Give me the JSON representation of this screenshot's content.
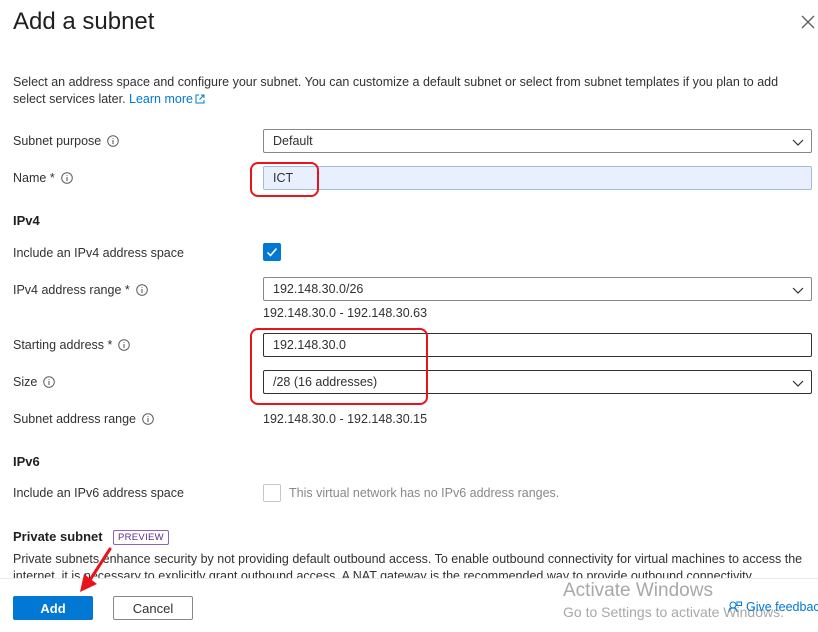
{
  "panel": {
    "title": "Add a subnet",
    "description": "Select an address space and configure your subnet. You can customize a default subnet or select from subnet templates if you plan to add select services later.",
    "learn_more": "Learn more"
  },
  "fields": {
    "subnet_purpose": {
      "label": "Subnet purpose",
      "value": "Default"
    },
    "name": {
      "label": "Name *",
      "value": "ICT"
    },
    "ipv4_section": "IPv4",
    "include_ipv4": {
      "label": "Include an IPv4 address space",
      "checked": true
    },
    "ipv4_range": {
      "label": "IPv4 address range *",
      "value": "192.148.30.0/26",
      "range_text": "192.148.30.0 - 192.148.30.63"
    },
    "starting_address": {
      "label": "Starting address *",
      "value": "192.148.30.0"
    },
    "size": {
      "label": "Size",
      "value": "/28 (16 addresses)"
    },
    "subnet_range": {
      "label": "Subnet address range",
      "value": "192.148.30.0 - 192.148.30.15"
    },
    "ipv6_section": "IPv6",
    "include_ipv6": {
      "label": "Include an IPv6 address space",
      "checked": false,
      "note": "This virtual network has no IPv6 address ranges."
    },
    "private_subnet": {
      "heading": "Private subnet",
      "badge": "PREVIEW",
      "description": "Private subnets enhance security by not providing default outbound access. To enable outbound connectivity for virtual machines to access the internet, it is necessary to explicitly grant outbound access. A NAT gateway is the recommended way to provide outbound connectivity."
    }
  },
  "footer": {
    "add_label": "Add",
    "cancel_label": "Cancel",
    "feedback_label": "Give feedback"
  },
  "watermark": {
    "line1": "Activate Windows",
    "line2": "Go to Settings to activate Windows."
  },
  "colors": {
    "accent": "#0078d4",
    "annotation": "#e8141b",
    "preview_badge": "#8764b8"
  }
}
